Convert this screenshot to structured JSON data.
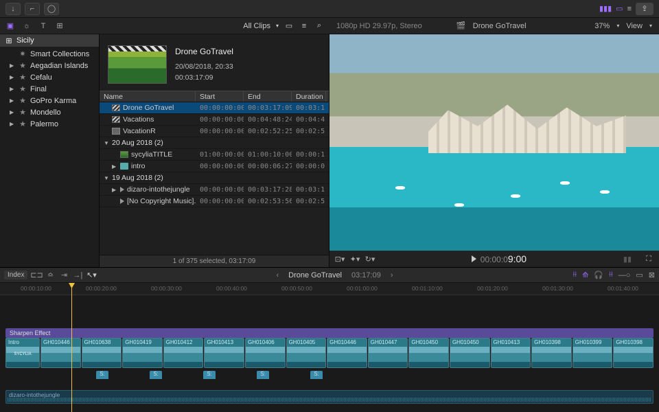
{
  "toolbar": {
    "allclips": "All Clips"
  },
  "project": {
    "format": "1080p HD 29.97p, Stereo",
    "title": "Drone GoTravel",
    "viewer_pct": "37%",
    "view_label": "View"
  },
  "sidebar": {
    "title": "Sicily",
    "items": [
      {
        "label": "Smart Collections",
        "leaf": true
      },
      {
        "label": "Aegadian Islands",
        "leaf": false
      },
      {
        "label": "Cefalu",
        "leaf": false
      },
      {
        "label": "Final",
        "leaf": false
      },
      {
        "label": "GoPro Karma",
        "leaf": false
      },
      {
        "label": "Mondello",
        "leaf": false
      },
      {
        "label": "Palermo",
        "leaf": false
      }
    ]
  },
  "preview": {
    "title": "Drone GoTravel",
    "date": "20/08/2018, 20:33",
    "duration": "00:03:17:09"
  },
  "table": {
    "cols": [
      "Name",
      "Start",
      "End",
      "Duration"
    ],
    "rows": [
      {
        "type": "clip",
        "icon": "clapper",
        "indent": 1,
        "name": "Drone GoTravel",
        "start": "00:00:00:00",
        "end": "00:03:17:09",
        "dur": "00:03:1",
        "sel": true
      },
      {
        "type": "clip",
        "icon": "clapper",
        "indent": 1,
        "name": "Vacations",
        "start": "00:00:00:00",
        "end": "00:04:48:24",
        "dur": "00:04:4"
      },
      {
        "type": "clip",
        "icon": "box",
        "indent": 1,
        "name": "VacationR",
        "start": "00:00:00:00",
        "end": "00:02:52:25",
        "dur": "00:02:5"
      },
      {
        "type": "group",
        "name": "20 Aug 2018  (2)"
      },
      {
        "type": "clip",
        "icon": "img",
        "indent": 2,
        "name": "sycyliaTITLE",
        "start": "01:00:00:00",
        "end": "01:00:10:00",
        "dur": "00:00:1"
      },
      {
        "type": "clip",
        "icon": "folder",
        "indent": 1,
        "expand": true,
        "name": "intro",
        "start": "00:00:00:00",
        "end": "00:00:06:27",
        "dur": "00:00:0"
      },
      {
        "type": "group",
        "name": "19 Aug 2018  (2)"
      },
      {
        "type": "clip",
        "icon": "speaker",
        "indent": 1,
        "expand": true,
        "name": "dizaro-intothejungle",
        "start": "00:00:00:00",
        "end": "00:03:17:28",
        "dur": "00:03:1"
      },
      {
        "type": "clip",
        "icon": "speaker",
        "indent": 2,
        "name": "[No Copyright Music]...",
        "start": "00:00:00:00",
        "end": "00:02:53:56",
        "dur": "00:02:5"
      }
    ]
  },
  "browser_foot": "1 of 375 selected, 03:17:09",
  "viewer": {
    "timecode_prefix": "00:00:0",
    "timecode_big": "9:00"
  },
  "timeline": {
    "index_label": "Index",
    "title": "Drone GoTravel",
    "duration": "03:17:09",
    "ruler": [
      "00:00:10:00",
      "00:00:20:00",
      "00:00:30:00",
      "00:00:40:00",
      "00:00:50:00",
      "00:01:00:00",
      "00:01:10:00",
      "00:01:20:00",
      "00:01:30:00",
      "00:01:40:00"
    ],
    "effect": "Sharpen Effect",
    "clips": [
      "Intro",
      "GH010446",
      "GH010638",
      "GH010419",
      "GH010412",
      "GH010413",
      "GH010406",
      "GH010405",
      "GH010446",
      "GH010447",
      "GH010450",
      "GH010450",
      "GH010413",
      "GH010398",
      "GH010399",
      "GH010398"
    ],
    "intro_badge": "SYCYLIA",
    "marker": "S:",
    "audio_label": "dizaro-intothejungle"
  }
}
